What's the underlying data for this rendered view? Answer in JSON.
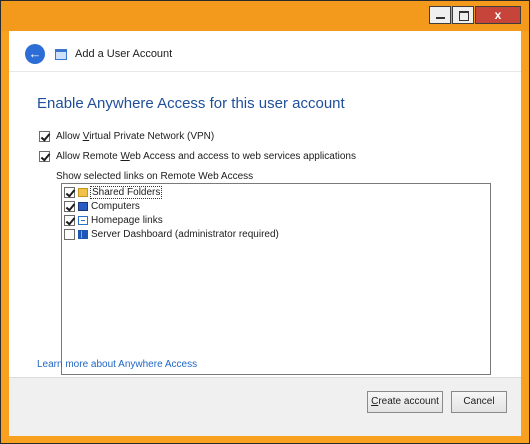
{
  "window": {
    "close_label": "x"
  },
  "header": {
    "back_glyph": "←",
    "title": "Add a User Account"
  },
  "main": {
    "heading": "Enable Anywhere Access for this user account",
    "vpn": {
      "label_pre": "Allow ",
      "label_ul": "V",
      "label_post": "irtual Private Network (VPN)",
      "checked": true
    },
    "rwa": {
      "label_pre": "Allow Remote ",
      "label_ul": "W",
      "label_post": "eb Access and access to web services applications",
      "checked": true
    },
    "links_label": "Show selected links on Remote Web Access",
    "links": [
      {
        "label": "Shared Folders",
        "checked": true,
        "icon": "folder-icon"
      },
      {
        "label": "Computers",
        "checked": true,
        "icon": "computer-icon"
      },
      {
        "label": "Homepage links",
        "checked": true,
        "icon": "homepage-links-icon"
      },
      {
        "label": "Server Dashboard (administrator required)",
        "checked": false,
        "icon": "dashboard-icon"
      }
    ],
    "learn_more": "Learn more about Anywhere Access"
  },
  "footer": {
    "create_pre": "",
    "create_ul": "C",
    "create_post": "reate account",
    "cancel": "Cancel"
  },
  "colors": {
    "frame": "#f39a1c",
    "heading": "#1f4f9b",
    "link": "#1f66c5",
    "back_button": "#2c6ed5",
    "close_button": "#c7443a"
  }
}
